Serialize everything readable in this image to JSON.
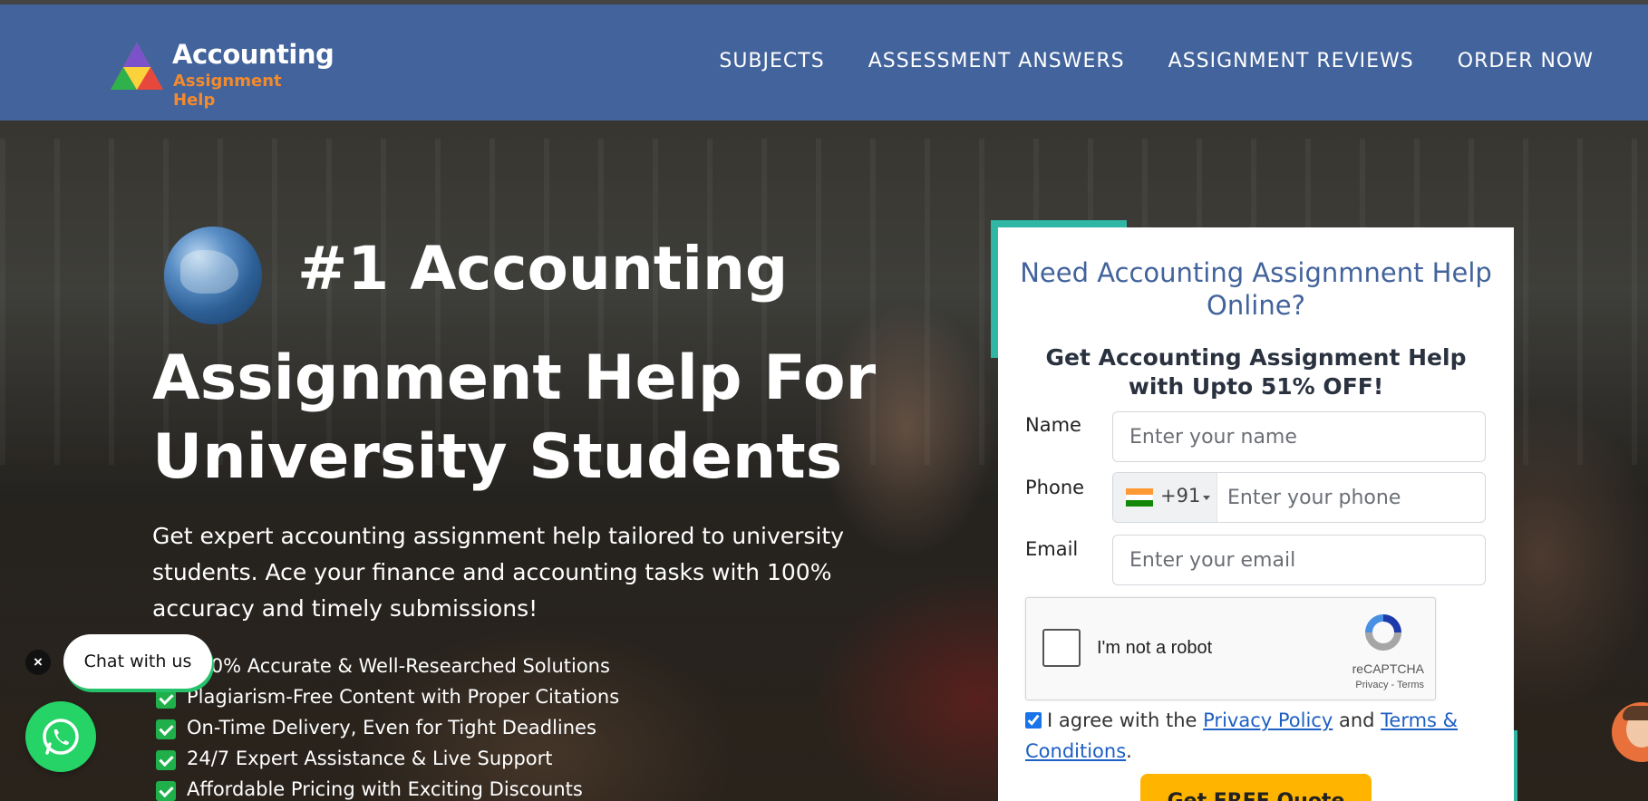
{
  "header": {
    "logo_title": "Accounting",
    "logo_subtitle": "Assignment Help",
    "nav": [
      "SUBJECTS",
      "ASSESSMENT ANSWERS",
      "ASSIGNMENT REVIEWS",
      "ORDER NOW"
    ],
    "background_color": "#42639b"
  },
  "hero": {
    "title_line1": "#1 Accounting",
    "title_line2": "Assignment Help For",
    "title_line3": "University Students",
    "lead": "Get expert accounting assignment help tailored to university students. Ace your finance and accounting tasks with 100% accuracy and timely submissions!",
    "bullets": [
      "100% Accurate & Well-Researched Solutions",
      "Plagiarism-Free Content with Proper Citations",
      "On-Time Delivery, Even for Tight Deadlines",
      "24/7 Expert Assistance & Live Support",
      "Affordable Pricing with Exciting Discounts"
    ]
  },
  "chat": {
    "close": "×",
    "bubble": "Chat with us",
    "icon": "whatsapp-icon"
  },
  "form": {
    "title": "Need Accounting Assignmnent Help Online?",
    "subtitle": "Get Accounting Assignment Help with Upto 51% OFF!",
    "name_label": "Name",
    "name_placeholder": "Enter your name",
    "phone_label": "Phone",
    "phone_code": "+91",
    "phone_placeholder": "Enter your phone",
    "email_label": "Email",
    "email_placeholder": "Enter your email",
    "captcha_text": "I'm not a robot",
    "captcha_brand": "reCAPTCHA",
    "captcha_links": "Privacy - Terms",
    "agree_prefix": "I agree with the",
    "privacy_link": "Privacy Policy",
    "agree_and": "and",
    "terms_link": "Terms & Conditions",
    "agree_suffix": ".",
    "agree_checked": true,
    "cta": "Get FREE Quote",
    "accent_color": "#2fb6a4",
    "cta_color": "#ffb400"
  }
}
